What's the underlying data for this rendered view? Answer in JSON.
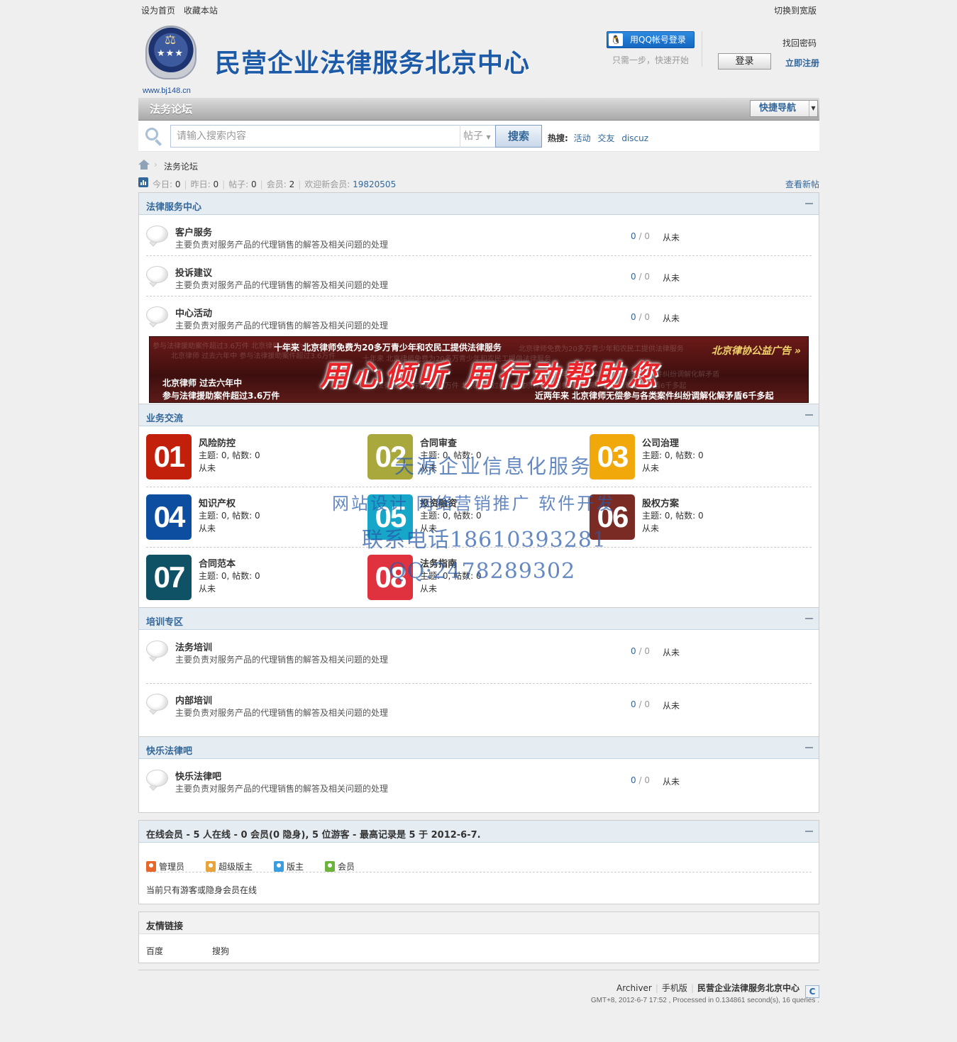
{
  "topbar": {
    "set_home": "设为首页",
    "bookmark": "收藏本站",
    "switch_wide": "切换到宽版"
  },
  "header": {
    "logo_url_text": "www.bj148.cn",
    "site_title": "民营企业法律服务北京中心",
    "qq_login": "用QQ帐号登录",
    "qq_tip": "只需一步，快速开始",
    "forgot_password": "找回密码",
    "login": "登录",
    "register": "立即注册"
  },
  "nav": {
    "current": "法务论坛",
    "quick_nav": "快捷导航"
  },
  "search": {
    "placeholder": "请输入搜索内容",
    "type": "帖子",
    "button": "搜索",
    "hot_label": "热搜:",
    "hot_terms": [
      "活动",
      "交友",
      "discuz"
    ]
  },
  "breadcrumb": {
    "current": "法务论坛"
  },
  "stats": {
    "today_label": "今日:",
    "today": "0",
    "yesterday_label": "昨日:",
    "yesterday": "0",
    "posts_label": "帖子:",
    "posts": "0",
    "members_label": "会员:",
    "members": "2",
    "newest_label": "欢迎新会员:",
    "newest": "19820505",
    "view_new": "查看新帖"
  },
  "sections": {
    "legal": {
      "title": "法律服务中心",
      "forums": [
        {
          "name": "客户服务",
          "desc": "主要负责对服务产品的代理销售的解答及相关问题的处理",
          "threads": "0",
          "posts": "0",
          "last": "从未"
        },
        {
          "name": "投诉建议",
          "desc": "主要负责对服务产品的代理销售的解答及相关问题的处理",
          "threads": "0",
          "posts": "0",
          "last": "从未"
        },
        {
          "name": "中心活动",
          "desc": "主要负责对服务产品的代理销售的解答及相关问题的处理",
          "threads": "0",
          "posts": "0",
          "last": "从未"
        }
      ]
    },
    "banner": {
      "line1": "十年来  北京律师免费为20多万青少年和农民工提供法律服务",
      "tag": "北京律协公益广告 »",
      "slogan": "用心倾听  用行动帮助您",
      "line3": "北京律师  过去六年中",
      "line4": "参与法律援助案件超过3.6万件",
      "line5": "近两年来  北京律师无偿参与各类案件纠纷调解化解矛盾6千多起"
    },
    "business": {
      "title": "业务交流",
      "forums": [
        {
          "num": "01",
          "name": "风险防控",
          "meta": "主题: 0, 帖数: 0",
          "last": "从未",
          "color": "#c3200c"
        },
        {
          "num": "02",
          "name": "合同审查",
          "meta": "主题: 0, 帖数: 0",
          "last": "从未",
          "color": "#a9a83c"
        },
        {
          "num": "03",
          "name": "公司治理",
          "meta": "主题: 0, 帖数: 0",
          "last": "从未",
          "color": "#f1a80b"
        },
        {
          "num": "04",
          "name": "知识产权",
          "meta": "主题: 0, 帖数: 0",
          "last": "从未",
          "color": "#0d4ea0"
        },
        {
          "num": "05",
          "name": "投资融资",
          "meta": "主题: 0, 帖数: 0",
          "last": "从未",
          "color": "#15a6c8"
        },
        {
          "num": "06",
          "name": "股权方案",
          "meta": "主题: 0, 帖数: 0",
          "last": "从未",
          "color": "#7a2c24"
        },
        {
          "num": "07",
          "name": "合同范本",
          "meta": "主题: 0, 帖数: 0",
          "last": "从未",
          "color": "#0f5165"
        },
        {
          "num": "08",
          "name": "法务指南",
          "meta": "主题: 0, 帖数: 0",
          "last": "从未",
          "color": "#e0323e"
        }
      ]
    },
    "training": {
      "title": "培训专区",
      "forums": [
        {
          "name": "法务培训",
          "desc": "主要负责对服务产品的代理销售的解答及相关问题的处理",
          "threads": "0",
          "posts": "0",
          "last": "从未"
        },
        {
          "name": "内部培训",
          "desc": "主要负责对服务产品的代理销售的解答及相关问题的处理",
          "threads": "0",
          "posts": "0",
          "last": "从未"
        }
      ]
    },
    "fun": {
      "title": "快乐法律吧",
      "forums": [
        {
          "name": "快乐法律吧",
          "desc": "主要负责对服务产品的代理销售的解答及相关问题的处理",
          "threads": "0",
          "posts": "0",
          "last": "从未"
        }
      ]
    }
  },
  "watermark": {
    "line1": "天源企业信息化服务",
    "line2": "网站设计 网络营销推广 软件开发",
    "line3": "联系电话18610393281",
    "line4": "QQ:2478289302"
  },
  "online": {
    "title": "在线会员 - 5 人在线 - 0 会员(0 隐身), 5 位游客 - 最高记录是 5 于 2012-6-7.",
    "legend": [
      "管理员",
      "超级版主",
      "版主",
      "会员"
    ],
    "note": "当前只有游客或隐身会员在线"
  },
  "links": {
    "title": "友情链接",
    "items": [
      "百度",
      "搜狗"
    ]
  },
  "footer": {
    "archiver": "Archiver",
    "mobile": "手机版",
    "site": "民营企业法律服务北京中心",
    "info": "GMT+8, 2012-6-7 17:52 , Processed in 0.134861 second(s), 16 queries ."
  },
  "colors": {
    "accent": "#336699",
    "header_bg": "#e5edf2",
    "page_bg": "#efefef"
  }
}
